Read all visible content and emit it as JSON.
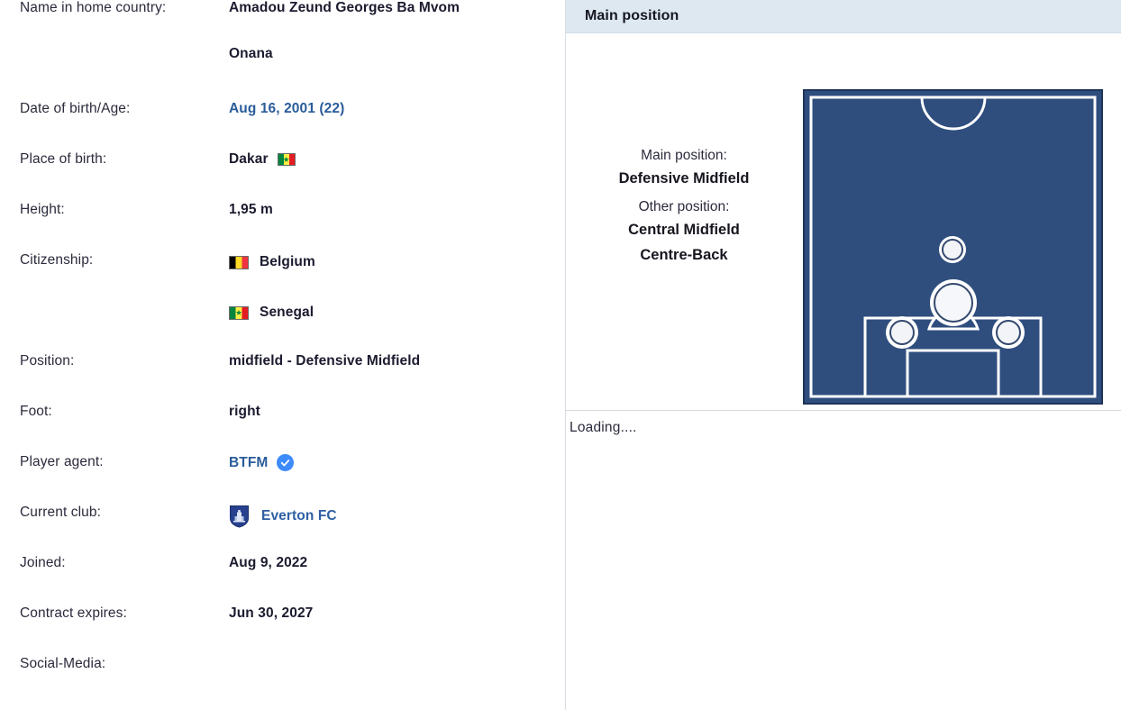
{
  "profile": {
    "rows": [
      {
        "label": "Name in home country:",
        "value_line1": "Amadou Zeund Georges Ba Mvom",
        "value_line2": "Onana",
        "type": "name"
      },
      {
        "label": "Date of birth/Age:",
        "value": "Aug 16, 2001 (22)",
        "type": "link"
      },
      {
        "label": "Place of birth:",
        "value": "Dakar",
        "flag": "senegal",
        "type": "text-flag"
      },
      {
        "label": "Height:",
        "value": "1,95 m",
        "type": "text"
      },
      {
        "label": "Citizenship:",
        "value": "Belgium",
        "value2": "Senegal",
        "flag": "belgium",
        "flag2": "senegal",
        "type": "citizenship"
      },
      {
        "label": "Position:",
        "value": "midfield - Defensive Midfield",
        "type": "text"
      },
      {
        "label": "Foot:",
        "value": "right",
        "type": "text"
      },
      {
        "label": "Player agent:",
        "value": "BTFM",
        "badge": "verified-icon",
        "type": "agent"
      },
      {
        "label": "Current club:",
        "value": "Everton FC",
        "badge": "everton-crest-icon",
        "type": "club"
      },
      {
        "label": "Joined:",
        "value": "Aug 9, 2022",
        "type": "text"
      },
      {
        "label": "Contract expires:",
        "value": "Jun 30, 2027",
        "type": "text"
      },
      {
        "label": "Social-Media:",
        "value": "",
        "type": "text"
      }
    ]
  },
  "position_panel": {
    "header_title": "Main position",
    "main_position_caption": "Main position:",
    "main_position": "Defensive Midfield",
    "other_position_caption": "Other position:",
    "other_positions": [
      "Central Midfield",
      "Centre-Back"
    ],
    "pitch": {
      "field_color": "#2f4e7e",
      "line_color": "#ffffff",
      "markers": [
        {
          "name": "central-midfield-marker",
          "role": "Central Midfield",
          "x": 50,
          "y": 51,
          "size": "small"
        },
        {
          "name": "defensive-midfield-marker",
          "role": "Defensive Midfield",
          "x": 50,
          "y": 67,
          "size": "large"
        },
        {
          "name": "centre-back-left-marker",
          "role": "Centre-Back",
          "x": 33,
          "y": 77,
          "size": "small"
        },
        {
          "name": "centre-back-right-marker",
          "role": "Centre-Back",
          "x": 69,
          "y": 77,
          "size": "small"
        }
      ]
    }
  },
  "status": {
    "loading_text": "Loading...."
  },
  "colors": {
    "link": "#2a5c9a",
    "header_bar": "#dde8f1",
    "pitch_fill": "#2f4e7e",
    "verified_badge": "#3d8bfd"
  }
}
